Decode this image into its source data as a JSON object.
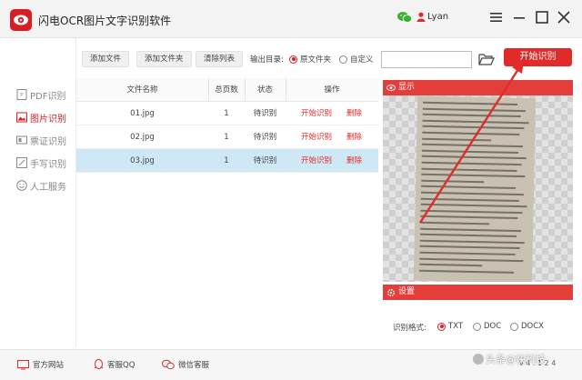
{
  "app": {
    "title": "闪电OCR图片文字识别软件"
  },
  "user": {
    "name": "Lyan"
  },
  "sidebar": {
    "items": [
      {
        "label": "PDF识别",
        "icon": "pdf-icon"
      },
      {
        "label": "图片识别",
        "icon": "image-icon",
        "active": true
      },
      {
        "label": "票证识别",
        "icon": "ticket-icon"
      },
      {
        "label": "手写识别",
        "icon": "handwriting-icon"
      },
      {
        "label": "人工服务",
        "icon": "smiley-icon"
      }
    ]
  },
  "toolbar": {
    "add_file": "添加文件",
    "add_folder": "添加文件夹",
    "clear_list": "清除列表",
    "output_label": "输出目录:",
    "output_options": [
      "原文件夹",
      "自定义"
    ],
    "output_selected": "原文件夹",
    "path_value": "",
    "start_button": "开始识别"
  },
  "table": {
    "headers": [
      "文件名称",
      "总页数",
      "状态",
      "操作"
    ],
    "rows": [
      {
        "name": "01.jpg",
        "pages": "1",
        "status": "待识别",
        "action_start": "开始识别",
        "action_delete": "删除",
        "selected": false
      },
      {
        "name": "02.jpg",
        "pages": "1",
        "status": "待识别",
        "action_start": "开始识别",
        "action_delete": "删除",
        "selected": false
      },
      {
        "name": "03.jpg",
        "pages": "1",
        "status": "待识别",
        "action_start": "开始识别",
        "action_delete": "删除",
        "selected": true
      }
    ]
  },
  "preview": {
    "title": "显示"
  },
  "settings": {
    "title": "设置",
    "format_label": "识别格式:",
    "formats": [
      "TXT",
      "DOC",
      "DOCX"
    ],
    "selected_format": "TXT"
  },
  "statusbar": {
    "website": "官方网站",
    "qq": "客服QQ",
    "wechat": "微信客服",
    "version": "v 4 . 1 2 4"
  },
  "watermark": "头条@快科技",
  "colors": {
    "accent": "#e12b2b",
    "header_red": "#e43e3b",
    "selected_row": "#cfe8f6"
  }
}
